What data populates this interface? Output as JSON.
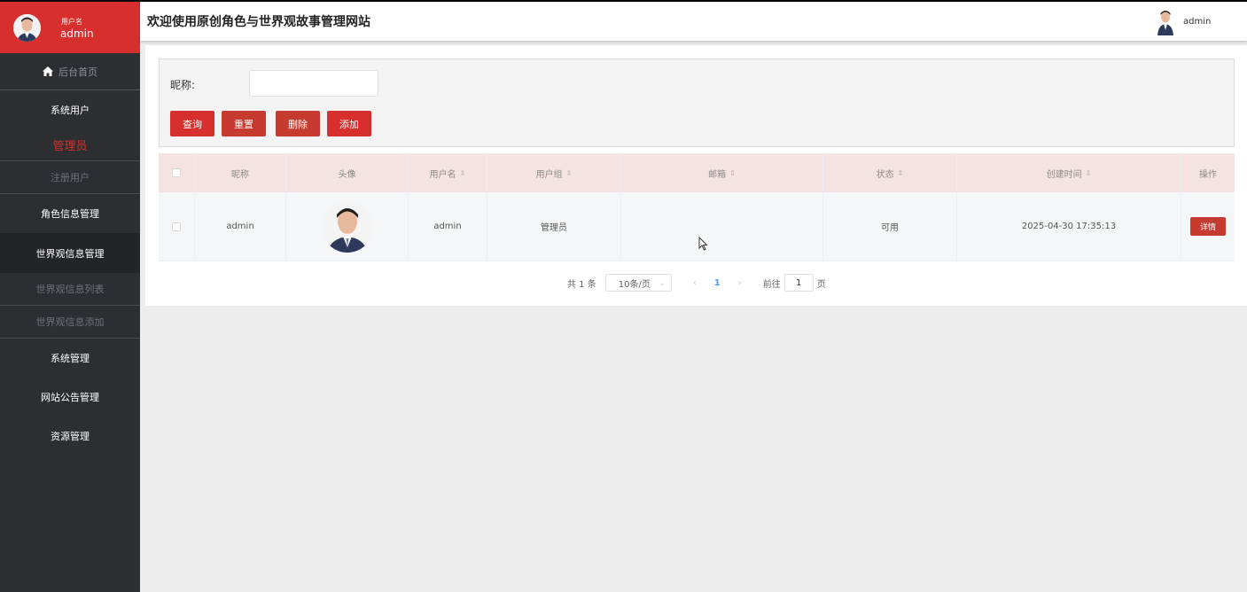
{
  "sidebar": {
    "user_role_label": "用户名",
    "user_name": "admin",
    "items": [
      {
        "label": "后台首页"
      },
      {
        "label": "系统用户"
      },
      {
        "label": "管理员"
      },
      {
        "label": "注册用户"
      },
      {
        "label": "角色信息管理"
      },
      {
        "label": "世界观信息管理"
      },
      {
        "label": "世界观信息列表"
      },
      {
        "label": "世界观信息添加"
      },
      {
        "label": "系统管理"
      },
      {
        "label": "网站公告管理"
      },
      {
        "label": "资源管理"
      }
    ]
  },
  "header": {
    "title": "欢迎使用原创角色与世界观故事管理网站",
    "user": "admin"
  },
  "search": {
    "label": "昵称:",
    "value": "",
    "buttons": {
      "query": "查询",
      "reset": "重置",
      "delete": "删除",
      "add": "添加"
    }
  },
  "table": {
    "columns": [
      "昵称",
      "头像",
      "用户名",
      "用户组",
      "邮箱",
      "状态",
      "创建时间",
      "操作"
    ],
    "rows": [
      {
        "nickname": "admin",
        "username": "admin",
        "group": "管理员",
        "email": "",
        "status": "可用",
        "created": "2025-04-30 17:35:13",
        "action": "详情"
      }
    ]
  },
  "pagination": {
    "total": "共 1 条",
    "page_size": "10条/页",
    "current": "1",
    "goto_label": "前往",
    "goto_value": "1",
    "page_suffix": "页"
  },
  "colors": {
    "brand_red": "#d72f2d",
    "sidebar_bg": "#2c2e32",
    "table_header_bg": "#f5e2e2",
    "page_link": "#409eff"
  }
}
